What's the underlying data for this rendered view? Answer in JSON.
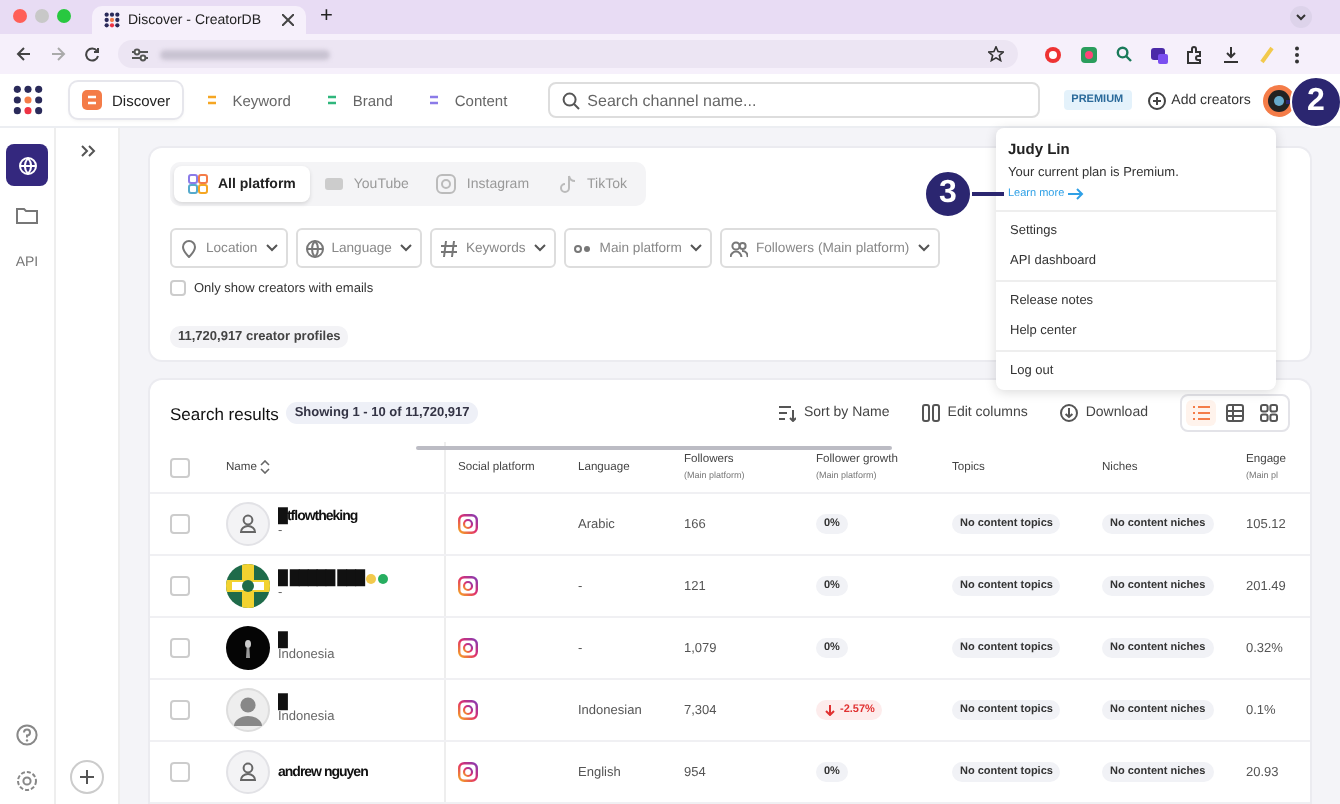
{
  "browser": {
    "tab_title": "Discover - CreatorDB",
    "new_tab": "+"
  },
  "nav": {
    "tabs": [
      {
        "label": "Discover",
        "selected": true,
        "kind": "discover"
      },
      {
        "label": "Keyword",
        "selected": false,
        "kind": "keyword"
      },
      {
        "label": "Brand",
        "selected": false,
        "kind": "brand"
      },
      {
        "label": "Content",
        "selected": false,
        "kind": "content"
      }
    ],
    "search": {
      "placeholder": "Search channel name..."
    },
    "plan_badge": "PREMIUM",
    "add_button": "Add creators"
  },
  "rail": {
    "items": [
      {
        "kind": "globe",
        "selected": true
      },
      {
        "kind": "folder",
        "selected": false
      },
      {
        "kind": "text",
        "label": "API",
        "selected": false
      }
    ]
  },
  "platforms": [
    {
      "label": "All platform",
      "selected": true,
      "kind": "all"
    },
    {
      "label": "YouTube",
      "selected": false,
      "kind": "youtube"
    },
    {
      "label": "Instagram",
      "selected": false,
      "kind": "instagram"
    },
    {
      "label": "TikTok",
      "selected": false,
      "kind": "tiktok"
    }
  ],
  "filters": [
    {
      "label": "Location",
      "kind": "location"
    },
    {
      "label": "Language",
      "kind": "language"
    },
    {
      "label": "Keywords",
      "kind": "keywords"
    },
    {
      "label": "Main platform",
      "kind": "platform"
    },
    {
      "label": "Followers (Main platform)",
      "kind": "followers"
    }
  ],
  "email_filter": {
    "label": "Only show creators with emails",
    "checked": false
  },
  "profile_count": "11,720,917 creator profiles",
  "results": {
    "title": "Search results",
    "showing": "Showing 1 - 10 of 11,720,917",
    "actions": [
      {
        "label": "Sort by Name",
        "kind": "sort"
      },
      {
        "label": "Edit columns",
        "kind": "columns"
      },
      {
        "label": "Download",
        "kind": "download"
      }
    ],
    "views": [
      {
        "kind": "list",
        "selected": true
      },
      {
        "kind": "table",
        "selected": false
      },
      {
        "kind": "grid",
        "selected": false
      }
    ],
    "select_all": {
      "checked": false
    },
    "columns": [
      {
        "label": "Name"
      },
      {
        "label": "Social platform"
      },
      {
        "label": "Language"
      },
      {
        "label": "Followers",
        "sub": "(Main platform)"
      },
      {
        "label": "Follower growth",
        "sub": "(Main platform)"
      },
      {
        "label": "Topics"
      },
      {
        "label": "Niches"
      },
      {
        "label": "Engage",
        "sub": "(Main pl"
      }
    ],
    "rows": [
      {
        "checked": false,
        "avatar": {
          "kind": "outline"
        },
        "name": "█tflowtheking",
        "sub": "-",
        "badges": [],
        "language": "Arabic",
        "followers": "166",
        "growth": {
          "label": "0%",
          "kind": "flat"
        },
        "topics": "No content topics",
        "niches": "No content niches",
        "engagement": "105.12"
      },
      {
        "checked": false,
        "avatar": {
          "kind": "picture"
        },
        "name": "█ █████ ███",
        "sub": "-",
        "badges": [
          {
            "color": "#f2c94c"
          },
          {
            "color": "#27ae60"
          }
        ],
        "language": "-",
        "followers": "121",
        "growth": {
          "label": "0%",
          "kind": "flat"
        },
        "topics": "No content topics",
        "niches": "No content niches",
        "engagement": "201.49"
      },
      {
        "checked": false,
        "avatar": {
          "kind": "dark"
        },
        "name": "█",
        "sub": "Indonesia",
        "badges": [],
        "language": "-",
        "followers": "1,079",
        "growth": {
          "label": "0%",
          "kind": "flat"
        },
        "topics": "No content topics",
        "niches": "No content niches",
        "engagement": "0.32%"
      },
      {
        "checked": false,
        "avatar": {
          "kind": "silhouette"
        },
        "name": "█",
        "sub": "Indonesia",
        "badges": [],
        "language": "Indonesian",
        "followers": "7,304",
        "growth": {
          "label": "-2.57%",
          "kind": "down"
        },
        "topics": "No content topics",
        "niches": "No content niches",
        "engagement": "0.1%"
      },
      {
        "checked": false,
        "avatar": {
          "kind": "outline"
        },
        "name": "andrew nguyen",
        "badges": [],
        "language": "English",
        "followers": "954",
        "growth": {
          "label": "0%",
          "kind": "flat"
        },
        "topics": "No content topics",
        "niches": "No content niches",
        "engagement": "20.93"
      }
    ]
  },
  "menu": {
    "name": "Judy Lin",
    "plan": "Your current plan is Premium.",
    "link": "Learn more",
    "groups": [
      [
        "Settings",
        "API dashboard"
      ],
      [
        "Release notes",
        "Help center"
      ],
      [
        "Log out"
      ]
    ]
  },
  "annotations": [
    {
      "label": "2",
      "kind": "avatar"
    },
    {
      "label": "3",
      "kind": "link"
    }
  ]
}
